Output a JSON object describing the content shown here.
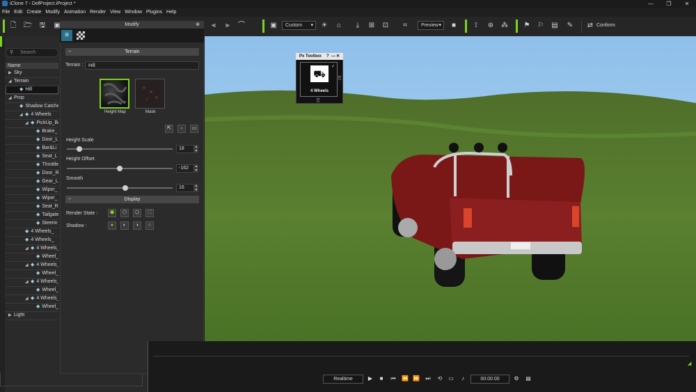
{
  "app": {
    "title": "iClone 7 - DefProject.iProject *",
    "min": "—",
    "max": "❐",
    "close": "✕"
  },
  "menu": [
    "File",
    "Edit",
    "Create",
    "Modify",
    "Animation",
    "Render",
    "View",
    "Window",
    "Plugins",
    "Help"
  ],
  "toolbar": {
    "camera_mode": "Custom",
    "preview": "Preview",
    "conform": "Conform"
  },
  "scene": {
    "search_placeholder": "Search",
    "name_header": "Name",
    "rows": [
      {
        "label": "Sky",
        "depth": 0,
        "arrow": "▶"
      },
      {
        "label": "Terrain",
        "depth": 0,
        "arrow": "◢"
      },
      {
        "label": "Hill",
        "depth": 2,
        "arrow": "",
        "selected": true
      },
      {
        "label": "Prop",
        "depth": 0,
        "arrow": "◢"
      },
      {
        "label": "Shadow Catcher",
        "depth": 2,
        "arrow": ""
      },
      {
        "label": "4 Wheels",
        "depth": 2,
        "arrow": "◢"
      },
      {
        "label": "PickUp_Body",
        "depth": 3,
        "arrow": "◢"
      },
      {
        "label": "Brake_",
        "depth": 5,
        "arrow": ""
      },
      {
        "label": "Door_L",
        "depth": 5,
        "arrow": ""
      },
      {
        "label": "Bar&Li",
        "depth": 5,
        "arrow": ""
      },
      {
        "label": "Seat_L",
        "depth": 5,
        "arrow": ""
      },
      {
        "label": "Throttle",
        "depth": 5,
        "arrow": ""
      },
      {
        "label": "Door_R",
        "depth": 5,
        "arrow": ""
      },
      {
        "label": "Gear_L",
        "depth": 5,
        "arrow": ""
      },
      {
        "label": "Wiper_",
        "depth": 5,
        "arrow": ""
      },
      {
        "label": "Wiper_",
        "depth": 5,
        "arrow": ""
      },
      {
        "label": "Seat_R",
        "depth": 5,
        "arrow": ""
      },
      {
        "label": "Tailgate",
        "depth": 5,
        "arrow": ""
      },
      {
        "label": "Steerin",
        "depth": 5,
        "arrow": ""
      },
      {
        "label": "4 Wheels_",
        "depth": 3,
        "arrow": ""
      },
      {
        "label": "4 Wheels_",
        "depth": 3,
        "arrow": ""
      },
      {
        "label": "4 Wheels_",
        "depth": 3,
        "arrow": "◢"
      },
      {
        "label": "Wheel_",
        "depth": 5,
        "arrow": ""
      },
      {
        "label": "4 Wheels_",
        "depth": 3,
        "arrow": "◢"
      },
      {
        "label": "Wheel_",
        "depth": 5,
        "arrow": ""
      },
      {
        "label": "4 Wheels_",
        "depth": 3,
        "arrow": "◢"
      },
      {
        "label": "Wheel_",
        "depth": 5,
        "arrow": ""
      },
      {
        "label": "4 Wheels_",
        "depth": 3,
        "arrow": "◢"
      },
      {
        "label": "Wheel_",
        "depth": 5,
        "arrow": ""
      },
      {
        "label": "Light",
        "depth": 0,
        "arrow": "▶"
      }
    ]
  },
  "modify": {
    "title": "Modify",
    "terrain_section": "Terrain",
    "terrain_label": "Terrain :",
    "terrain_value": "Hill",
    "heightmap_label": "Height Map",
    "mask_label": "Mask",
    "height_scale": {
      "label": "Height Scale",
      "value": "18",
      "fraction": 0.12
    },
    "height_offset": {
      "label": "Height Offset",
      "value": "-162",
      "fraction": 0.5
    },
    "smooth": {
      "label": "Smooth",
      "value": "16",
      "fraction": 0.55
    },
    "display_section": "Display",
    "render_state_label": "Render State :",
    "shadow_label": "Shadow :"
  },
  "pxtoolbox": {
    "title": "Px Toolbox",
    "help": "?",
    "minimize": "—",
    "close": "✕",
    "item_label": "4 Wheels"
  },
  "timeline": {
    "mode": "Realtime",
    "timecode": "00:00:00"
  },
  "colors": {
    "accent": "#7ed321",
    "sky": "#9cc8ee",
    "grass": "#4e7a2a"
  }
}
